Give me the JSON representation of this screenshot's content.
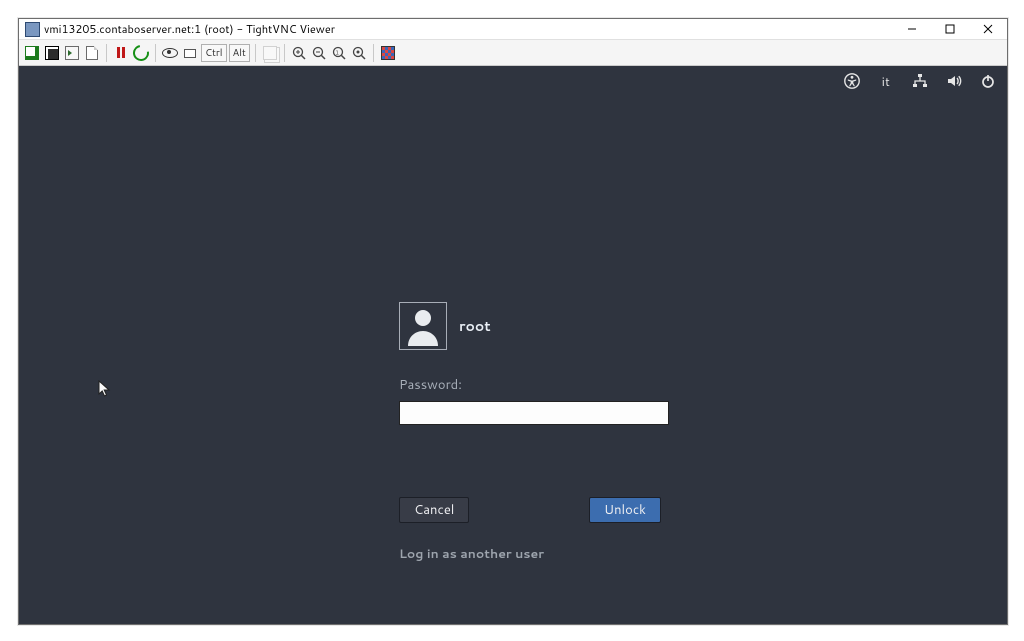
{
  "window": {
    "title": "vmi13205.contaboserver.net:1 (root) - TightVNC Viewer"
  },
  "toolbar": {
    "ctrl_label": "Ctrl",
    "alt_label": "Alt"
  },
  "topbar": {
    "language": "it"
  },
  "login": {
    "username": "root",
    "password_label": "Password:",
    "password_value": "",
    "cancel_label": "Cancel",
    "unlock_label": "Unlock",
    "alt_user_label": "Log in as another user"
  }
}
